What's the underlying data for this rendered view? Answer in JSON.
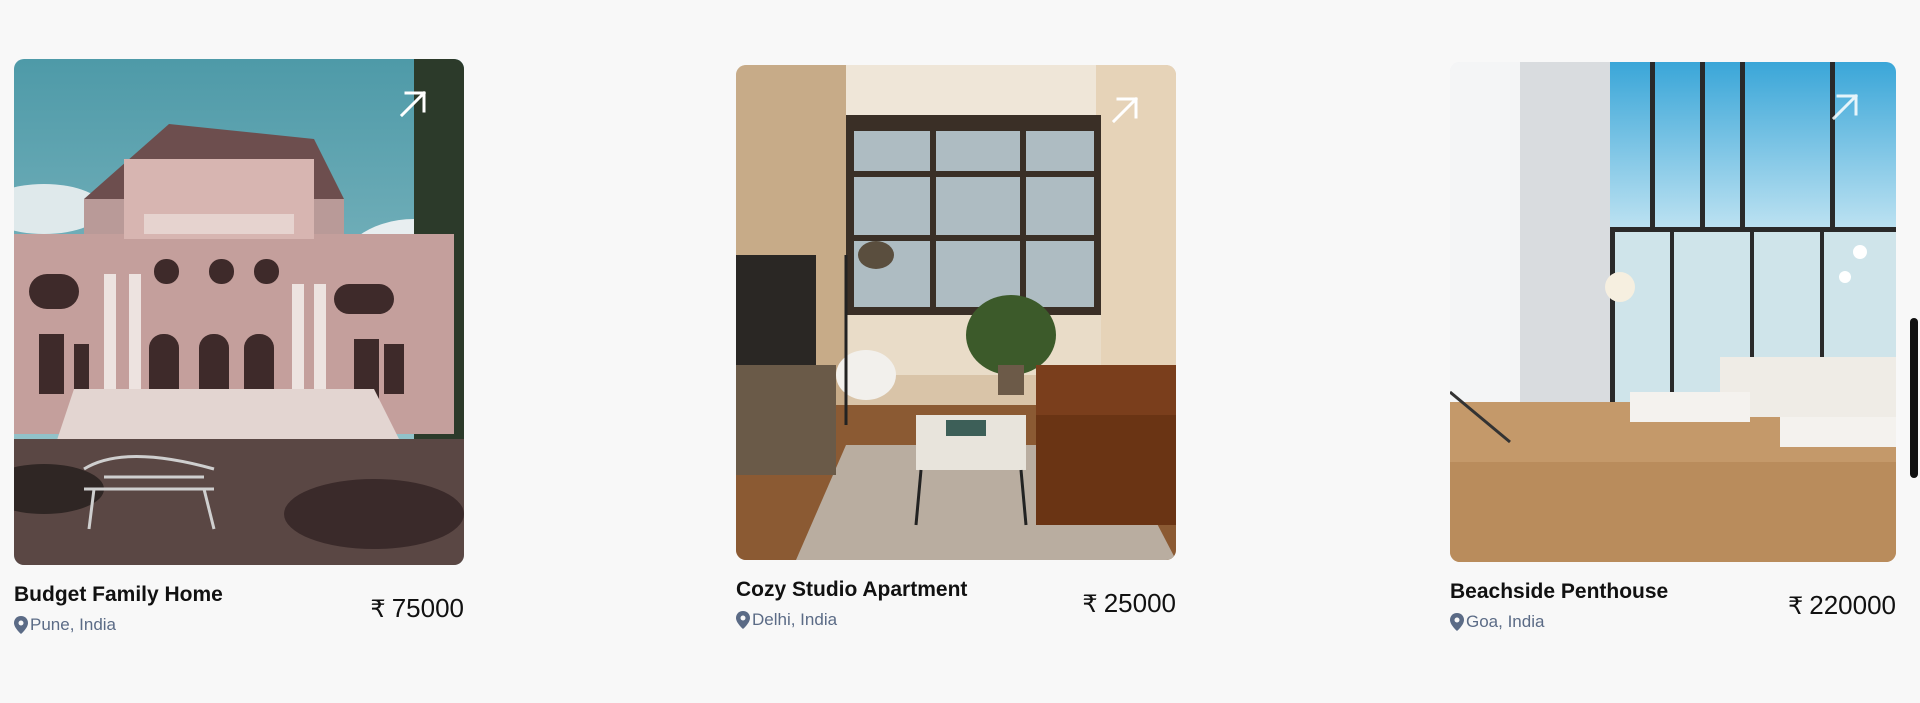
{
  "listings": [
    {
      "title": "Budget Family Home",
      "location": "Pune, India",
      "currency": "₹",
      "price": "75000",
      "image_icon": "house-photo"
    },
    {
      "title": "Cozy Studio Apartment",
      "location": "Delhi, India",
      "currency": "₹",
      "price": "25000",
      "image_icon": "living-room-photo"
    },
    {
      "title": "Beachside Penthouse",
      "location": "Goa, India",
      "currency": "₹",
      "price": "220000",
      "image_icon": "penthouse-photo"
    }
  ],
  "colors": {
    "background": "#f8f8f8",
    "location_text": "#5b6b86",
    "title_text": "#111111"
  }
}
